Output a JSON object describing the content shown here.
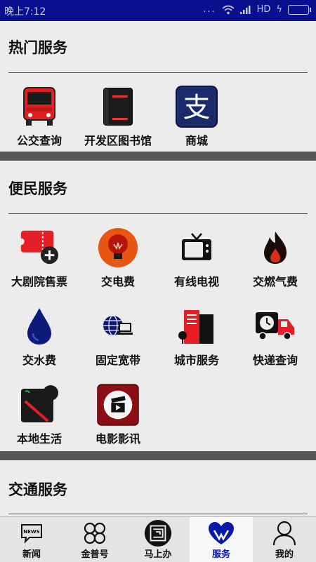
{
  "status_bar": {
    "time": "晚上7:12",
    "network": "HD",
    "dots": "..."
  },
  "hot": {
    "title": "热门服务",
    "items": [
      "公交查询",
      "开发区图书馆",
      "商城"
    ]
  },
  "convenience": {
    "title": "便民服务",
    "items": [
      "大剧院售票",
      "交电费",
      "有线电视",
      "交燃气费",
      "交水费",
      "固定宽带",
      "城市服务",
      "快递查询",
      "本地生活",
      "电影影讯"
    ]
  },
  "traffic": {
    "title": "交通服务"
  },
  "tabs": [
    {
      "label": "新闻",
      "icon": "news-icon"
    },
    {
      "label": "金普号",
      "icon": "clover-icon"
    },
    {
      "label": "马上办",
      "icon": "seal-icon"
    },
    {
      "label": "服务",
      "icon": "heart-hands-icon",
      "active": true
    },
    {
      "label": "我的",
      "icon": "person-icon"
    }
  ],
  "colors": {
    "status_bar": "#0a0f8f",
    "active_tab": "#0a1aa8",
    "divider": "#555555"
  }
}
